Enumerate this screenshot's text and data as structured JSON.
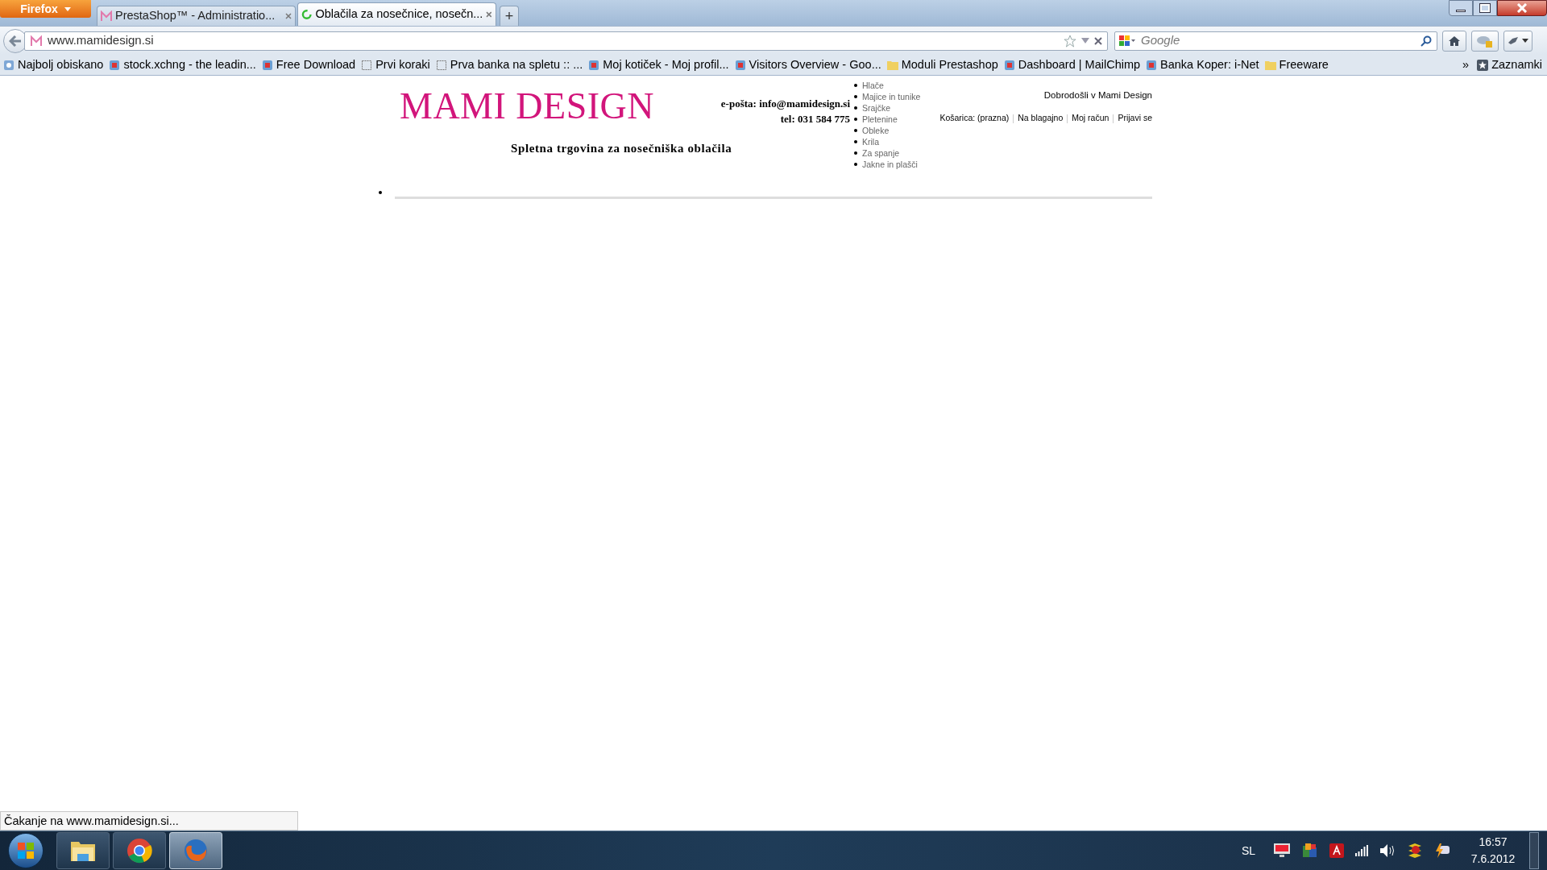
{
  "browser": {
    "app_button": "Firefox",
    "tabs": [
      {
        "title": "PrestaShop™ - Administratio...",
        "selected": false,
        "loading": false
      },
      {
        "title": "Oblačila za nosečnice, nosečn...",
        "selected": true,
        "loading": true
      }
    ],
    "new_tab": "+",
    "address": "www.mamidesign.si",
    "search_placeholder": "Google",
    "bookmarks": [
      {
        "label": "Najbolj obiskano",
        "kind": "smart"
      },
      {
        "label": "stock.xchng - the leadin...",
        "kind": "site"
      },
      {
        "label": "Free Download",
        "kind": "site"
      },
      {
        "label": "Prvi koraki",
        "kind": "blank"
      },
      {
        "label": "Prva banka na spletu :: ...",
        "kind": "blank"
      },
      {
        "label": "Moj kotiček - Moj profil...",
        "kind": "site"
      },
      {
        "label": "Visitors Overview - Goo...",
        "kind": "site"
      },
      {
        "label": "Moduli Prestashop",
        "kind": "folder"
      },
      {
        "label": "Dashboard | MailChimp",
        "kind": "site"
      },
      {
        "label": "Banka Koper: i-Net",
        "kind": "site"
      },
      {
        "label": "Freeware",
        "kind": "folder"
      }
    ],
    "more_bookmarks": "»",
    "bookmarks_menu": "Zaznamki"
  },
  "page": {
    "logo": "MAMI DESIGN",
    "email": "e-pošta: info@mamidesign.si",
    "phone": "tel: 031 584 775",
    "tagline": "Spletna trgovina za nosečniška oblačila",
    "categories": [
      "Hlače",
      "Majice in tunike",
      "Srajčke",
      "Pletenine",
      "Obleke",
      "Krila",
      "Za spanje",
      "Jakne in plašči"
    ],
    "welcome": "Dobrodošli v Mami Design",
    "header_links": [
      "Košarica: (prazna)",
      "Na blagajno",
      "Moj račun",
      "Prijavi se"
    ]
  },
  "status_bar": "Čakanje na www.mamidesign.si...",
  "taskbar": {
    "apps": [
      {
        "kind": "explorer",
        "selected": false
      },
      {
        "kind": "chrome",
        "selected": false
      },
      {
        "kind": "firefox",
        "selected": true
      }
    ],
    "language": "SL",
    "time": "16:57",
    "date": "7.6.2012"
  }
}
